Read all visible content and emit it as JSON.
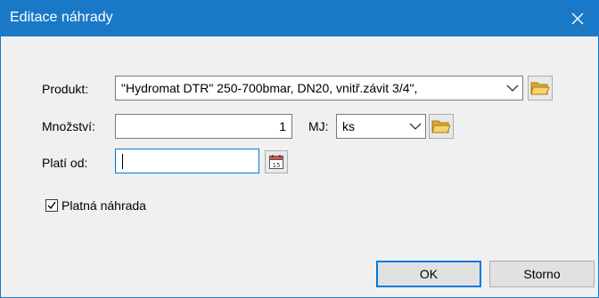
{
  "window": {
    "title": "Editace náhrady",
    "close_icon": "close-icon"
  },
  "form": {
    "produkt_label": "Produkt:",
    "produkt_value": "\"Hydromat DTR\" 250-700bmar, DN20, vnitř.závit 3/4\",",
    "mnozstvi_label": "Množství:",
    "mnozstvi_value": "1",
    "mj_label": "MJ:",
    "mj_value": "ks",
    "plati_od_label": "Platí od:",
    "plati_od_value": "",
    "platna_nahrada_label": "Platná náhrada",
    "platna_nahrada_checked": true
  },
  "buttons": {
    "ok": "OK",
    "storno": "Storno"
  },
  "icons": {
    "folder": "folder-open-icon",
    "calendar": "calendar-icon",
    "dropdown": "chevron-down-icon"
  },
  "colors": {
    "titlebar": "#1a79c6",
    "default_button_border": "#0078d7",
    "folder": "#f2c94c"
  }
}
